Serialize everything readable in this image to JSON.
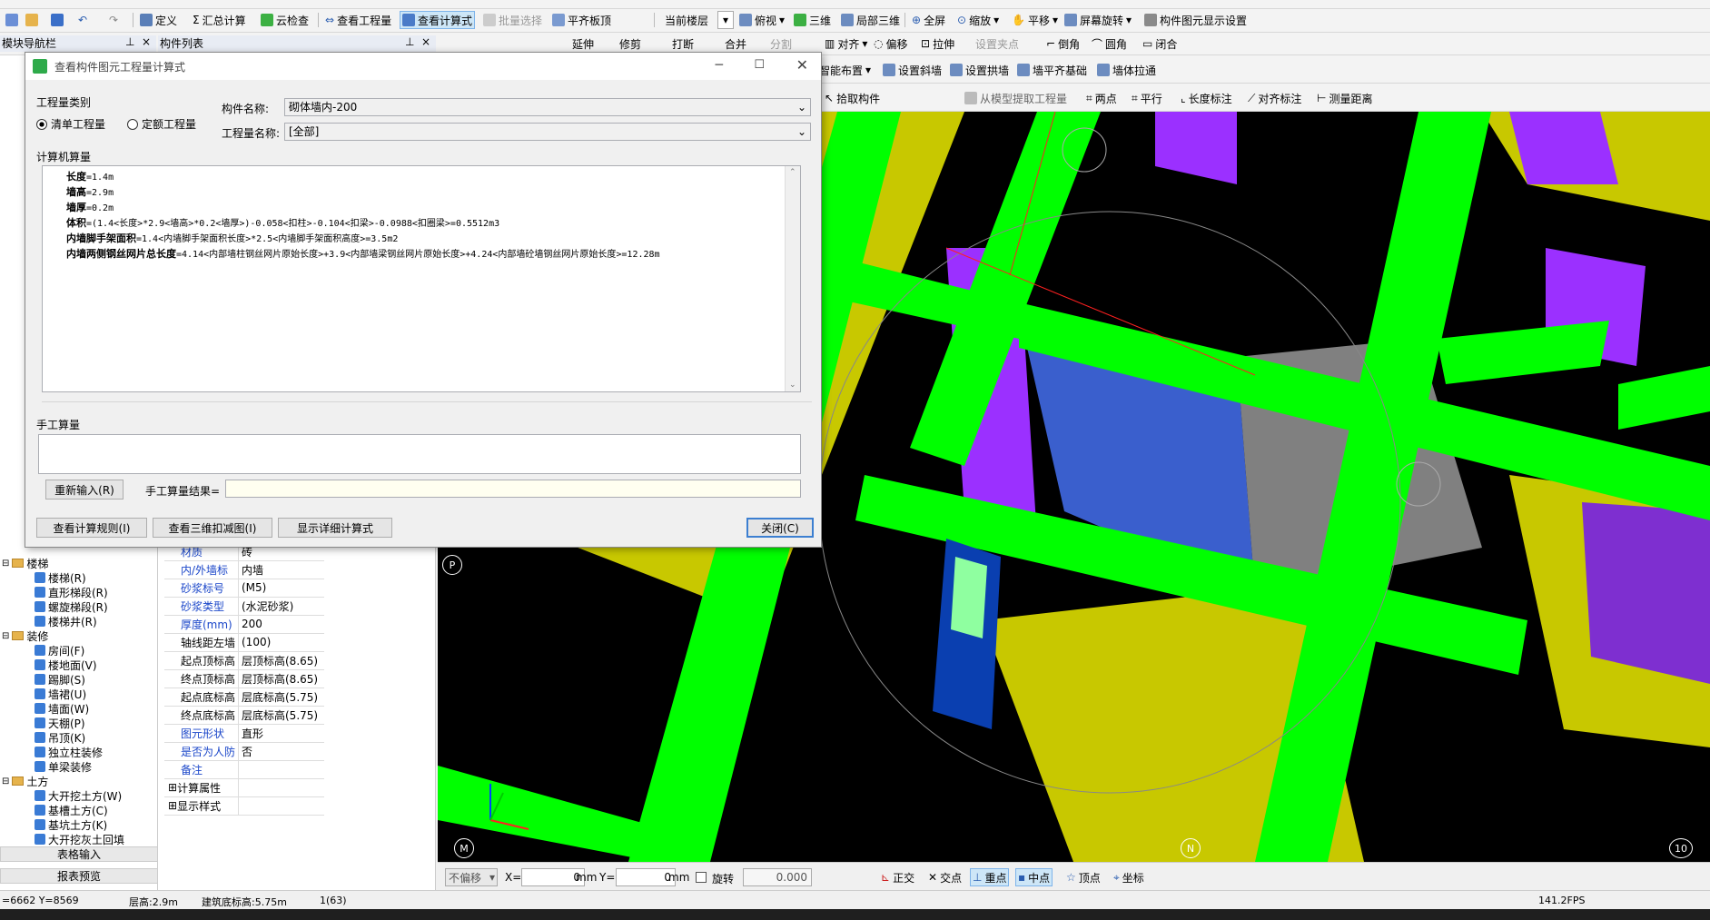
{
  "toolbar1": {
    "items": [
      "定义",
      "汇总计算",
      "云检查",
      "查看工程量",
      "查看计算式",
      "批量选择",
      "平齐板顶",
      "当前楼层",
      "俯视",
      "三维",
      "局部三维",
      "全屏",
      "缩放",
      "平移",
      "屏幕旋转",
      "构件图元显示设置"
    ]
  },
  "toolbar2": {
    "panel_left": "模块导航栏",
    "panel_mid": "构件列表",
    "items": [
      "延伸",
      "修剪",
      "打断",
      "合并",
      "分割",
      "对齐",
      "偏移",
      "拉伸",
      "设置夹点",
      "倒角",
      "圆角",
      "闭合"
    ]
  },
  "toolbar3": {
    "items": [
      "智能布置",
      "设置斜墙",
      "设置拱墙",
      "墙平齐基础",
      "墙体拉通"
    ]
  },
  "toolbar4": {
    "items": [
      "拾取构件",
      "从模型提取工程量",
      "两点",
      "平行",
      "长度标注",
      "对齐标注",
      "测量距离"
    ]
  },
  "dialog": {
    "title": "查看构件图元工程量计算式",
    "category_label": "工程量类别",
    "radio1": "清单工程量",
    "radio2": "定额工程量",
    "component_name_label": "构件名称:",
    "component_name_value": "砌体墙内-200",
    "quantity_name_label": "工程量名称:",
    "quantity_name_value": "[全部]",
    "computer_calc_label": "计算机算量",
    "calc_lines": [
      {
        "k": "长度",
        "v": "=1.4m"
      },
      {
        "k": "墙高",
        "v": "=2.9m"
      },
      {
        "k": "墙厚",
        "v": "=0.2m"
      },
      {
        "k": "体积",
        "v": "=(1.4<长度>*2.9<墙高>*0.2<墙厚>)-0.058<扣柱>-0.104<扣梁>-0.0988<扣圈梁>=0.5512m3"
      },
      {
        "k": "内墙脚手架面积",
        "v": "=1.4<内墙脚手架面积长度>*2.5<内墙脚手架面积高度>=3.5m2"
      },
      {
        "k": "内墙两侧钢丝网片总长度",
        "v": "=4.14<内部墙柱钢丝网片原始长度>+3.9<内部墙梁钢丝网片原始长度>+4.24<内部墙砼墙钢丝网片原始长度>=12.28m"
      }
    ],
    "manual_calc_label": "手工算量",
    "reinput_button": "重新输入(R)",
    "manual_result_label": "手工算量结果=",
    "view_rules_button": "查看计算规则(I)",
    "view_3d_button": "查看三维扣减图(I)",
    "show_detail_button": "显示详细计算式",
    "close_button": "关闭(C)"
  },
  "tree": {
    "items": [
      {
        "label": "楼梯",
        "folder": true
      },
      {
        "label": "楼梯(R)"
      },
      {
        "label": "直形梯段(R)"
      },
      {
        "label": "螺旋梯段(R)"
      },
      {
        "label": "楼梯井(R)"
      },
      {
        "label": "装修",
        "folder": true
      },
      {
        "label": "房间(F)"
      },
      {
        "label": "楼地面(V)"
      },
      {
        "label": "踢脚(S)"
      },
      {
        "label": "墙裙(U)"
      },
      {
        "label": "墙面(W)"
      },
      {
        "label": "天棚(P)"
      },
      {
        "label": "吊顶(K)"
      },
      {
        "label": "独立柱装修"
      },
      {
        "label": "单梁装修"
      },
      {
        "label": "土方",
        "folder": true
      },
      {
        "label": "大开挖土方(W)"
      },
      {
        "label": "基槽土方(C)"
      },
      {
        "label": "基坑土方(K)"
      },
      {
        "label": "大开挖灰土回填"
      }
    ],
    "footer1": "表格输入",
    "footer2": "报表预览"
  },
  "props": {
    "rows": [
      {
        "k": "材质",
        "v": "砖",
        "blue": true
      },
      {
        "k": "内/外墙标",
        "v": "内墙",
        "blue": true
      },
      {
        "k": "砂浆标号",
        "v": "(M5)",
        "blue": true
      },
      {
        "k": "砂浆类型",
        "v": "(水泥砂浆)",
        "blue": true
      },
      {
        "k": "厚度(mm)",
        "v": "200",
        "blue": true
      },
      {
        "k": "轴线距左墙",
        "v": "(100)",
        "blue": false
      },
      {
        "k": "起点顶标高",
        "v": "层顶标高(8.65)",
        "blue": false
      },
      {
        "k": "终点顶标高",
        "v": "层顶标高(8.65)",
        "blue": false
      },
      {
        "k": "起点底标高",
        "v": "层底标高(5.75)",
        "blue": false
      },
      {
        "k": "终点底标高",
        "v": "层底标高(5.75)",
        "blue": false
      },
      {
        "k": "图元形状",
        "v": "直形",
        "blue": true
      },
      {
        "k": "是否为人防",
        "v": "否",
        "blue": true
      },
      {
        "k": "备注",
        "v": "",
        "blue": true
      },
      {
        "k": "计算属性",
        "v": "",
        "blue": false,
        "plus": true
      },
      {
        "k": "显示样式",
        "v": "",
        "blue": false,
        "plus": true
      }
    ]
  },
  "viewport": {
    "labels": {
      "p": "P",
      "m": "M",
      "n": "N",
      "ten": "10"
    },
    "colors": {
      "bg": "#000000",
      "wall_green": "#00ff00",
      "yellow": "#c8c800",
      "purple": "#9b30ff",
      "blue_face": "#3a5fcd",
      "gray_face": "#808080"
    }
  },
  "bottom_toolbar": {
    "offset_mode": "不偏移",
    "x_label": "X=",
    "x_value": "0",
    "mm1": "mm",
    "y_label": "Y=",
    "y_value": "0",
    "mm2": "mm",
    "rotate_label": "旋转",
    "rotate_value": "0.000",
    "snap_items": [
      "正交",
      "交点",
      "重点",
      "中点",
      "顶点",
      "坐标"
    ]
  },
  "status": {
    "coords": "=6662 Y=8569",
    "floor_height": "层高:2.9m",
    "elevation": "建筑底标高:5.75m",
    "count": "1(63)",
    "fps": "141.2FPS"
  }
}
